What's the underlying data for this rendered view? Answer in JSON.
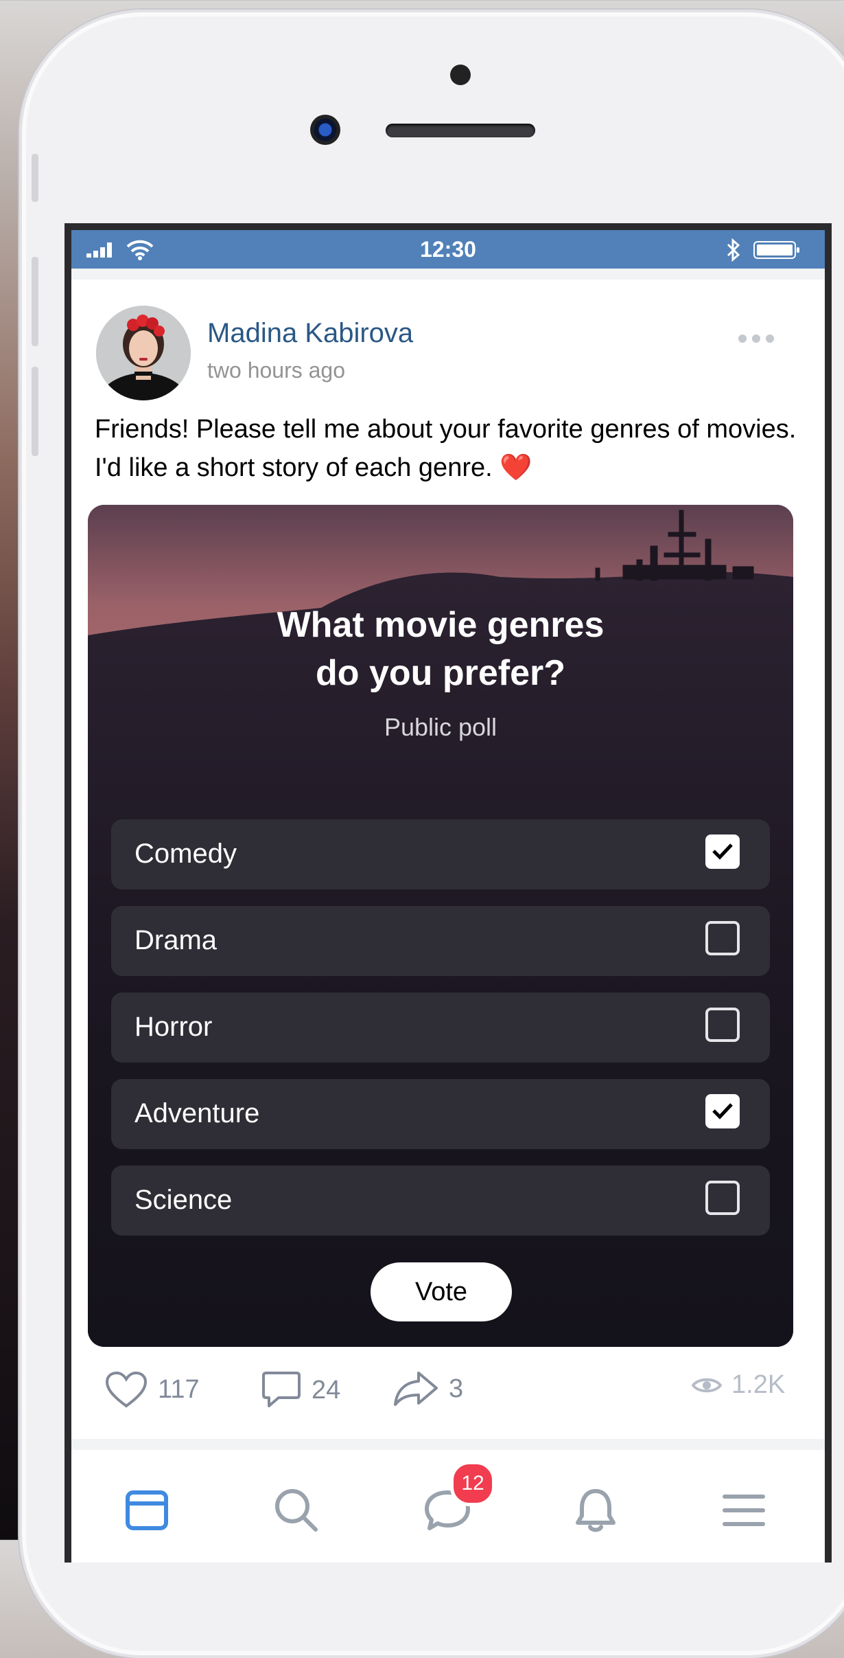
{
  "status_bar": {
    "time": "12:30"
  },
  "post": {
    "author": "Madina Kabirova",
    "time": "two hours ago",
    "text": "Friends! Please tell me about your favorite genres of movies. I'd like a short story of each genre. ❤️"
  },
  "poll": {
    "title_line1": "What movie genres",
    "title_line2": "do you prefer?",
    "subtitle": "Public poll",
    "options": [
      {
        "label": "Comedy",
        "checked": true
      },
      {
        "label": "Drama",
        "checked": false
      },
      {
        "label": "Horror",
        "checked": false
      },
      {
        "label": "Adventure",
        "checked": true
      },
      {
        "label": "Science",
        "checked": false
      }
    ],
    "vote_label": "Vote"
  },
  "actions": {
    "likes": "117",
    "comments": "24",
    "shares": "3",
    "views": "1.2K"
  },
  "tabbar": {
    "items": [
      "news-feed",
      "search",
      "messages",
      "notifications",
      "menu"
    ],
    "messages_badge": "12"
  },
  "colors": {
    "status_bar": "#5181b8",
    "author_link": "#2a5885",
    "badge": "#f23c4f",
    "active_tab": "#3f8ae0"
  }
}
